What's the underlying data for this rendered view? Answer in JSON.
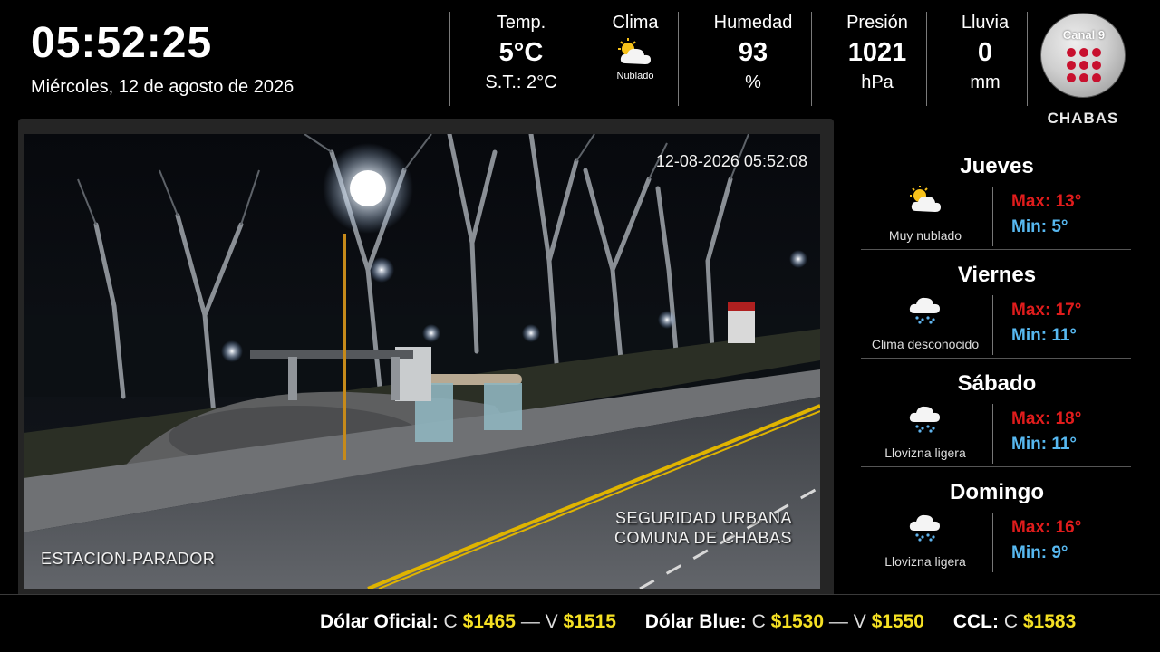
{
  "header": {
    "time": "05:52:25",
    "date": "Miércoles, 12 de agosto de 2026",
    "temp": {
      "label": "Temp.",
      "value": "5°C",
      "feels": "S.T.: 2°C"
    },
    "clima": {
      "label": "Clima",
      "icon": "partly-cloudy-icon",
      "desc": "Nublado"
    },
    "humedad": {
      "label": "Humedad",
      "value": "93",
      "unit": "%"
    },
    "presion": {
      "label": "Presión",
      "value": "1021",
      "unit": "hPa"
    },
    "lluvia": {
      "label": "Lluvia",
      "value": "0",
      "unit": "mm"
    },
    "logo": {
      "channel": "Canal 9",
      "city": "CHABAS"
    }
  },
  "camera": {
    "timestamp": "12-08-2026 05:52:08",
    "location": "ESTACION-PARADOR",
    "watermark_line1": "SEGURIDAD URBANA",
    "watermark_line2": "COMUNA DE CHABAS"
  },
  "forecast": [
    {
      "day": "Jueves",
      "icon": "partly-cloudy-icon",
      "desc": "Muy nublado",
      "max": "Max: 13°",
      "min": "Min: 5°"
    },
    {
      "day": "Viernes",
      "icon": "rain-cloud-icon",
      "desc": "Clima desconocido",
      "max": "Max: 17°",
      "min": "Min: 11°"
    },
    {
      "day": "Sábado",
      "icon": "rain-cloud-icon",
      "desc": "Llovizna ligera",
      "max": "Max: 18°",
      "min": "Min: 11°"
    },
    {
      "day": "Domingo",
      "icon": "rain-cloud-icon",
      "desc": "Llovizna ligera",
      "max": "Max: 16°",
      "min": "Min: 9°"
    }
  ],
  "ticker": [
    {
      "name": "Dólar Oficial:",
      "c_label": "C",
      "c": "$1465",
      "dash": "—",
      "v_label": "V",
      "v": "$1515"
    },
    {
      "name": "Dólar Blue:",
      "c_label": "C",
      "c": "$1530",
      "dash": "—",
      "v_label": "V",
      "v": "$1550"
    },
    {
      "name": "CCL:",
      "c_label": "C",
      "c": "$1583",
      "dash": "",
      "v_label": "",
      "v": ""
    }
  ],
  "colors": {
    "max_temp": "#e01c1c",
    "min_temp": "#57b8f0",
    "ticker_price": "#f5e023",
    "logo_dots": "#c8102e"
  }
}
